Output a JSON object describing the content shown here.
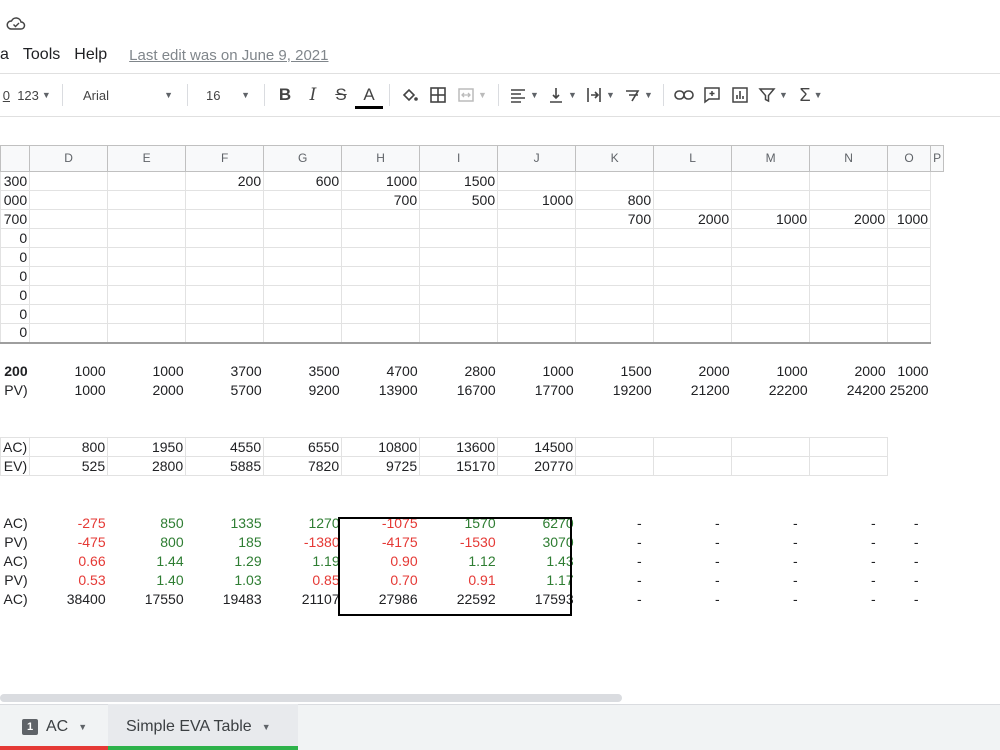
{
  "menu": {
    "items": [
      "a",
      "Tools",
      "Help"
    ],
    "last_edit": "Last edit was on June 9, 2021"
  },
  "toolbar": {
    "number_format": "123",
    "font": "Arial",
    "font_size": "16",
    "bold": "B",
    "italic": "I",
    "strikethrough": "S",
    "text_color": "A",
    "function": "Σ",
    "icons": [
      "percent-icon",
      "number-format-icon",
      "font-family-select",
      "font-size-select",
      "bold-icon",
      "italic-icon",
      "strikethrough-icon",
      "text-color-icon",
      "fill-color-icon",
      "borders-icon",
      "merge-icon",
      "align-icon",
      "valign-icon",
      "wrap-icon",
      "rotate-icon",
      "link-icon",
      "comment-icon",
      "chart-icon",
      "filter-icon",
      "functions-icon"
    ]
  },
  "columns": [
    "D",
    "E",
    "F",
    "G",
    "H",
    "I",
    "J",
    "K",
    "L",
    "M",
    "N",
    "O",
    "P"
  ],
  "rows": {
    "block1": [
      [
        "300",
        "",
        "",
        "200",
        "600",
        "1000",
        "1500",
        "",
        "",
        "",
        "",
        "",
        ""
      ],
      [
        "000",
        "",
        "",
        "",
        "",
        "700",
        "500",
        "1000",
        "800",
        "",
        "",
        "",
        ""
      ],
      [
        "700",
        "",
        "",
        "",
        "",
        "",
        "",
        "",
        "700",
        "2000",
        "1000",
        "2000",
        "1000"
      ],
      [
        "0",
        "",
        "",
        "",
        "",
        "",
        "",
        "",
        "",
        "",
        "",
        "",
        ""
      ],
      [
        "0",
        "",
        "",
        "",
        "",
        "",
        "",
        "",
        "",
        "",
        "",
        "",
        ""
      ],
      [
        "0",
        "",
        "",
        "",
        "",
        "",
        "",
        "",
        "",
        "",
        "",
        "",
        ""
      ],
      [
        "0",
        "",
        "",
        "",
        "",
        "",
        "",
        "",
        "",
        "",
        "",
        "",
        ""
      ],
      [
        "0",
        "",
        "",
        "",
        "",
        "",
        "",
        "",
        "",
        "",
        "",
        "",
        ""
      ],
      [
        "0",
        "",
        "",
        "",
        "",
        "",
        "",
        "",
        "",
        "",
        "",
        "",
        ""
      ]
    ],
    "totals": [
      [
        "200",
        "1000",
        "1000",
        "3700",
        "3500",
        "4700",
        "2800",
        "1000",
        "1500",
        "2000",
        "1000",
        "2000",
        "1000"
      ],
      [
        "PV)",
        "1000",
        "2000",
        "5700",
        "9200",
        "13900",
        "16700",
        "17700",
        "19200",
        "21200",
        "22200",
        "24200",
        "25200"
      ]
    ],
    "ac_ev": [
      [
        "AC)",
        "800",
        "1950",
        "4550",
        "6550",
        "10800",
        "13600",
        "14500",
        "",
        "",
        "",
        "",
        ""
      ],
      [
        "EV)",
        "525",
        "2800",
        "5885",
        "7820",
        "9725",
        "15170",
        "20770",
        "",
        "",
        "",
        "",
        ""
      ]
    ],
    "metrics": [
      [
        "AC)",
        "-275",
        "850",
        "1335",
        "1270",
        "-1075",
        "1570",
        "6270",
        "-",
        "-",
        "-",
        "-",
        "-"
      ],
      [
        "PV)",
        "-475",
        "800",
        "185",
        "-1380",
        "-4175",
        "-1530",
        "3070",
        "-",
        "-",
        "-",
        "-",
        "-"
      ],
      [
        "AC)",
        "0.66",
        "1.44",
        "1.29",
        "1.19",
        "0.90",
        "1.12",
        "1.43",
        "-",
        "-",
        "-",
        "-",
        "-"
      ],
      [
        "PV)",
        "0.53",
        "1.40",
        "1.03",
        "0.85",
        "0.70",
        "0.91",
        "1.17",
        "-",
        "-",
        "-",
        "-",
        "-"
      ],
      [
        "AC)",
        "38400",
        "17550",
        "19483",
        "21107",
        "27986",
        "22592",
        "17593",
        "-",
        "-",
        "-",
        "-",
        "-"
      ]
    ],
    "metric_colors": [
      [
        "",
        "red",
        "green",
        "green",
        "green",
        "red",
        "green",
        "green",
        "",
        "",
        "",
        "",
        ""
      ],
      [
        "",
        "red",
        "green",
        "green",
        "red",
        "red",
        "red",
        "green",
        "",
        "",
        "",
        "",
        ""
      ],
      [
        "",
        "red",
        "green",
        "green",
        "green",
        "red",
        "green",
        "green",
        "",
        "",
        "",
        "",
        ""
      ],
      [
        "",
        "red",
        "green",
        "green",
        "red",
        "red",
        "red",
        "green",
        "",
        "",
        "",
        "",
        ""
      ],
      [
        "",
        "",
        "",
        "",
        "",
        "",
        "",
        "",
        "",
        "",
        "",
        "",
        ""
      ]
    ]
  },
  "tabs": [
    {
      "label": "AC",
      "badge": "1",
      "color": "#e53935"
    },
    {
      "label": "Simple EVA Table",
      "color": "#2db24a"
    }
  ]
}
